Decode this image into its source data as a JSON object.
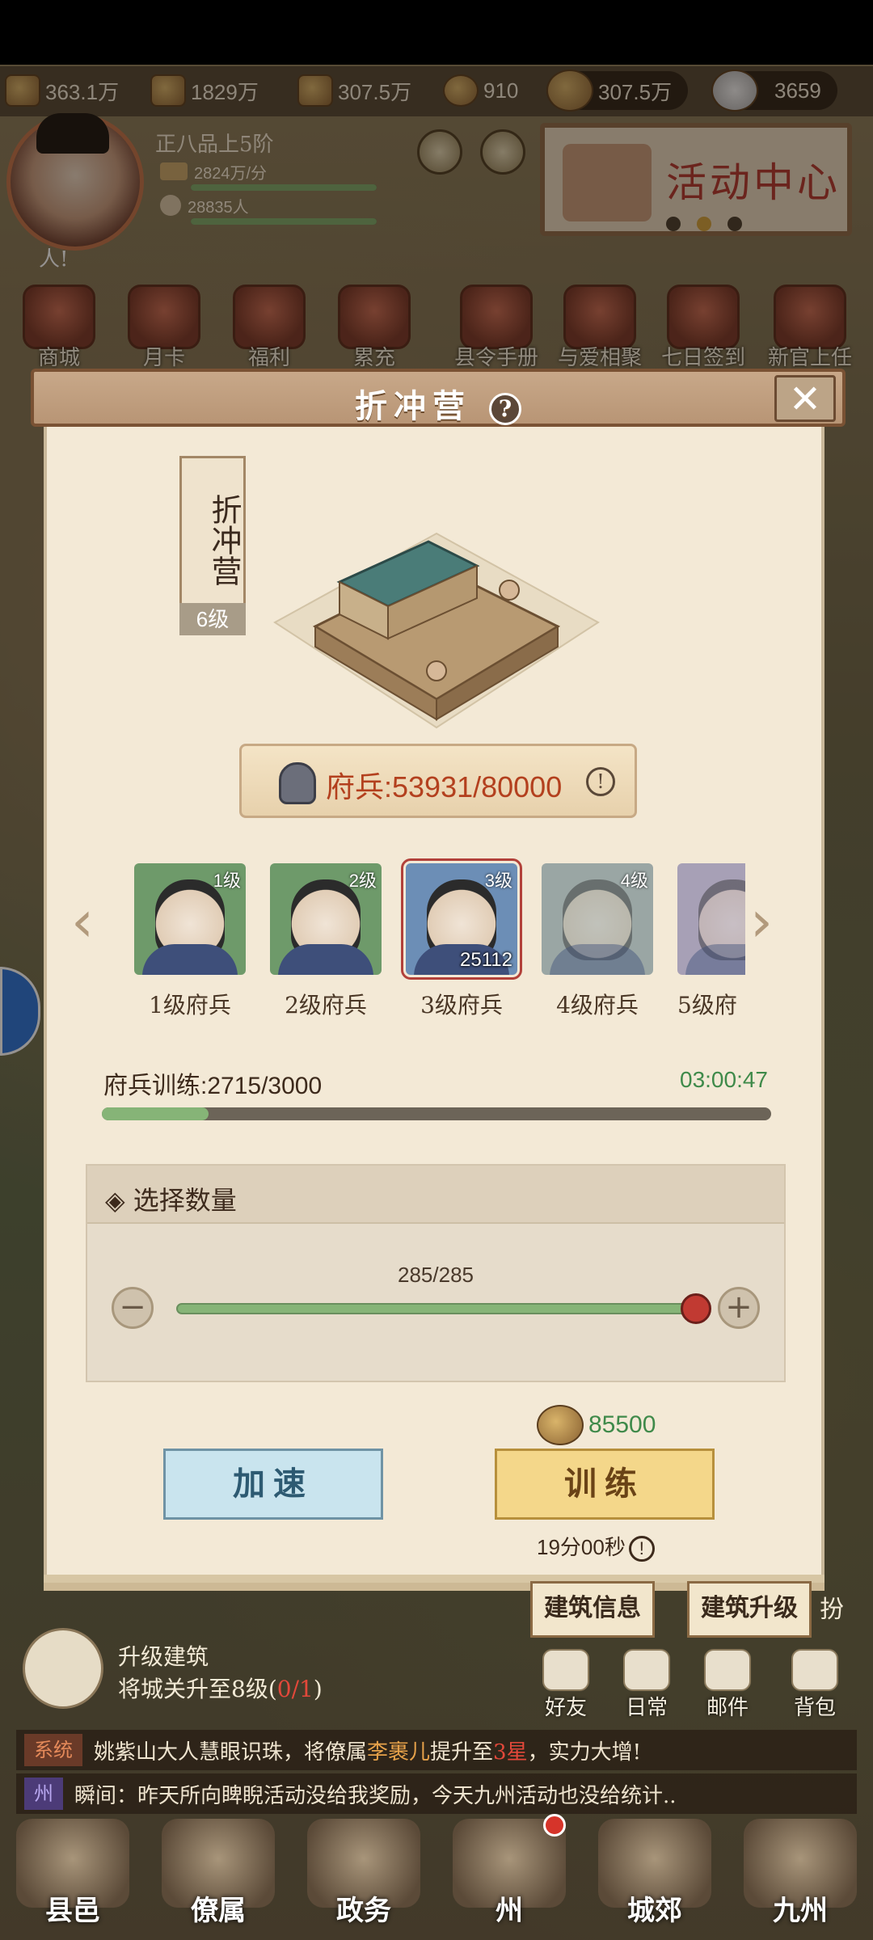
{
  "resources": {
    "items": [
      {
        "icon": "gold-ingot-icon",
        "value": "363.1万"
      },
      {
        "icon": "wood-icon",
        "value": "1829万"
      },
      {
        "icon": "grain-icon",
        "value": "307.5万"
      },
      {
        "icon": "coin-icon",
        "value": "910"
      }
    ],
    "highlight_money": "307.5万",
    "highlight_ingot": "3659"
  },
  "player": {
    "rank": "正八品上5阶",
    "income": "2824万/分",
    "population": "28835人",
    "shout": "人!"
  },
  "activity_center": {
    "title": "活动中心"
  },
  "top_icons": [
    "商城",
    "月卡",
    "福利",
    "累充",
    "县令手册",
    "与爱相聚",
    "七日签到",
    "新官上任"
  ],
  "modal": {
    "title": "折冲营",
    "help_glyph": "?",
    "close_glyph": "✕",
    "building_name": "折冲营",
    "building_level": "6级",
    "troops_label": "府兵:53931/80000",
    "info_glyph": "!",
    "soldiers": [
      {
        "level": "1级",
        "name": "1级府兵",
        "count": ""
      },
      {
        "level": "2级",
        "name": "2级府兵",
        "count": ""
      },
      {
        "level": "3级",
        "name": "3级府兵",
        "count": "25112"
      },
      {
        "level": "4级",
        "name": "4级府兵",
        "count": ""
      },
      {
        "level": "",
        "name": "5级府",
        "count": ""
      }
    ],
    "training_label": "府兵训练:2715/3000",
    "training_timer": "03:00:47",
    "training_progress": 0.16,
    "select_qty_label": "选择数量",
    "qty_value": "285/285",
    "cost": "85500",
    "speed_button": "加速",
    "train_button": "训练",
    "train_time": "19分00秒",
    "building_info_tab": "建筑信息",
    "building_upgrade_tab": "建筑升级",
    "extra_glyph": "扮"
  },
  "task": {
    "title": "升级建筑",
    "desc_prefix": "将城关升至8级(",
    "desc_progress": "0/1",
    "desc_suffix": ")"
  },
  "mini_icons": [
    "好友",
    "日常",
    "邮件",
    "背包"
  ],
  "chat": [
    {
      "tag": "系统",
      "p1": "姚紫山大人慧眼识珠，将僚属",
      "name": "李裹儿",
      "p2": "提升至",
      "star": "3星",
      "p3": "，实力大增!"
    },
    {
      "tag": "州",
      "text": "瞬间：昨天所向睥睨活动没给我奖励，今天九州活动也没给统计.."
    }
  ],
  "bottom_nav": [
    "县邑",
    "僚属",
    "政务",
    "州",
    "城郊",
    "九州"
  ]
}
